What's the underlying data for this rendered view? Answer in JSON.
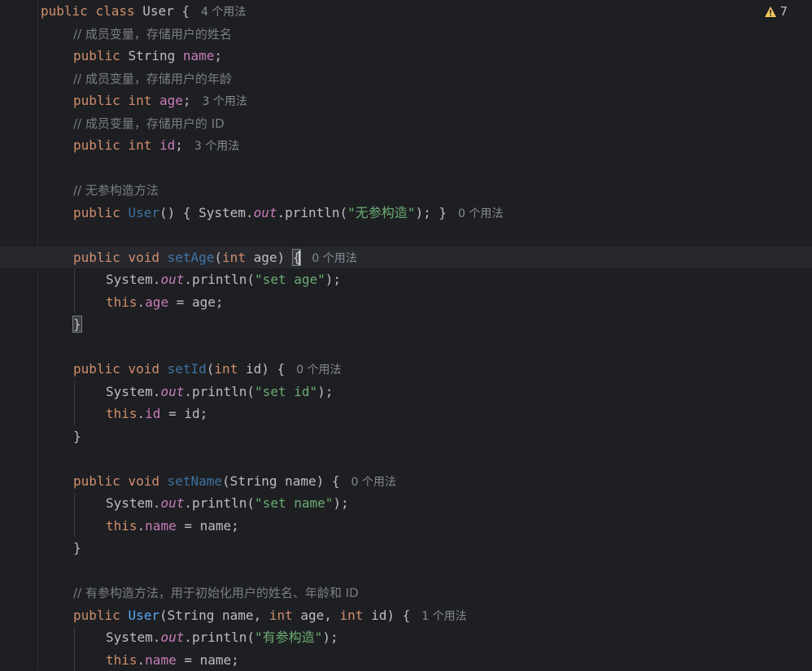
{
  "editor": {
    "warnings": {
      "icon": "warning-triangle-icon",
      "count": "7"
    },
    "lines": [
      {
        "code": [
          [
            "kw",
            "public "
          ],
          [
            "kw",
            "class "
          ],
          [
            "plain",
            "User "
          ],
          [
            "plain",
            "{"
          ]
        ],
        "hint": "4 个用法"
      },
      {
        "code": [
          [
            "cmt",
            "// 成员变量，存储用户的姓名"
          ]
        ]
      },
      {
        "code": [
          [
            "kw",
            "public "
          ],
          [
            "plain",
            "String "
          ],
          [
            "field",
            "name"
          ],
          [
            "plain",
            ";"
          ]
        ]
      },
      {
        "code": [
          [
            "cmt",
            "// 成员变量，存储用户的年龄"
          ]
        ]
      },
      {
        "code": [
          [
            "kw",
            "public "
          ],
          [
            "kw",
            "int "
          ],
          [
            "field",
            "age"
          ],
          [
            "plain",
            ";"
          ]
        ],
        "hint": "3 个用法"
      },
      {
        "code": [
          [
            "cmt",
            "// 成员变量，存储用户的 ID"
          ]
        ]
      },
      {
        "code": [
          [
            "kw",
            "public "
          ],
          [
            "kw",
            "int "
          ],
          [
            "field",
            "id"
          ],
          [
            "plain",
            ";"
          ]
        ],
        "hint": "3 个用法"
      },
      {
        "code": []
      },
      {
        "code": [
          [
            "cmt",
            "// 无参构造方法"
          ]
        ]
      },
      {
        "code": [
          [
            "kw",
            "public "
          ],
          [
            "ctor-unused",
            "User"
          ],
          [
            "plain",
            "() { System."
          ],
          [
            "static",
            "out"
          ],
          [
            "plain",
            ".println("
          ],
          [
            "str",
            "\"无参构造\""
          ],
          [
            "plain",
            "); }"
          ]
        ],
        "hint": "0 个用法"
      },
      {
        "code": []
      },
      {
        "code": [
          [
            "kw",
            "public "
          ],
          [
            "kw",
            "void "
          ],
          [
            "method-unused",
            "setAge"
          ],
          [
            "plain",
            "("
          ],
          [
            "kw",
            "int "
          ],
          [
            "plain",
            "age) "
          ],
          [
            "caret",
            "{"
          ]
        ],
        "hint": "0 个用法",
        "current": true
      },
      {
        "code": [
          [
            "plain",
            "System."
          ],
          [
            "static",
            "out"
          ],
          [
            "plain",
            ".println("
          ],
          [
            "str",
            "\"set age\""
          ],
          [
            "plain",
            ");"
          ]
        ]
      },
      {
        "code": [
          [
            "kw",
            "this"
          ],
          [
            "plain",
            "."
          ],
          [
            "field",
            "age"
          ],
          [
            "plain",
            " = age;"
          ]
        ]
      },
      {
        "code": [
          [
            "caret-close",
            "}"
          ]
        ]
      },
      {
        "code": []
      },
      {
        "code": [
          [
            "kw",
            "public "
          ],
          [
            "kw",
            "void "
          ],
          [
            "method-unused",
            "setId"
          ],
          [
            "plain",
            "("
          ],
          [
            "kw",
            "int "
          ],
          [
            "plain",
            "id) {"
          ]
        ],
        "hint": "0 个用法"
      },
      {
        "code": [
          [
            "plain",
            "System."
          ],
          [
            "static",
            "out"
          ],
          [
            "plain",
            ".println("
          ],
          [
            "str",
            "\"set id\""
          ],
          [
            "plain",
            ");"
          ]
        ]
      },
      {
        "code": [
          [
            "kw",
            "this"
          ],
          [
            "plain",
            "."
          ],
          [
            "field",
            "id"
          ],
          [
            "plain",
            " = id;"
          ]
        ]
      },
      {
        "code": [
          [
            "plain",
            "}"
          ]
        ]
      },
      {
        "code": []
      },
      {
        "code": [
          [
            "kw",
            "public "
          ],
          [
            "kw",
            "void "
          ],
          [
            "method-unused",
            "setName"
          ],
          [
            "plain",
            "(String name) {"
          ]
        ],
        "hint": "0 个用法"
      },
      {
        "code": [
          [
            "plain",
            "System."
          ],
          [
            "static",
            "out"
          ],
          [
            "plain",
            ".println("
          ],
          [
            "str",
            "\"set name\""
          ],
          [
            "plain",
            ");"
          ]
        ]
      },
      {
        "code": [
          [
            "kw",
            "this"
          ],
          [
            "plain",
            "."
          ],
          [
            "field",
            "name"
          ],
          [
            "plain",
            " = name;"
          ]
        ]
      },
      {
        "code": [
          [
            "plain",
            "}"
          ]
        ]
      },
      {
        "code": []
      },
      {
        "code": [
          [
            "cmt",
            "// 有参构造方法，用于初始化用户的姓名、年龄和 ID"
          ]
        ]
      },
      {
        "code": [
          [
            "kw",
            "public "
          ],
          [
            "ctor",
            "User"
          ],
          [
            "plain",
            "(String name, "
          ],
          [
            "kw",
            "int "
          ],
          [
            "plain",
            "age, "
          ],
          [
            "kw",
            "int "
          ],
          [
            "plain",
            "id) {"
          ]
        ],
        "hint": "1 个用法"
      },
      {
        "code": [
          [
            "plain",
            "System."
          ],
          [
            "static",
            "out"
          ],
          [
            "plain",
            ".println("
          ],
          [
            "str",
            "\"有参构造\""
          ],
          [
            "plain",
            ");"
          ]
        ]
      },
      {
        "code": [
          [
            "kw",
            "this"
          ],
          [
            "plain",
            "."
          ],
          [
            "field",
            "name"
          ],
          [
            "plain",
            " = name;"
          ]
        ]
      }
    ]
  }
}
